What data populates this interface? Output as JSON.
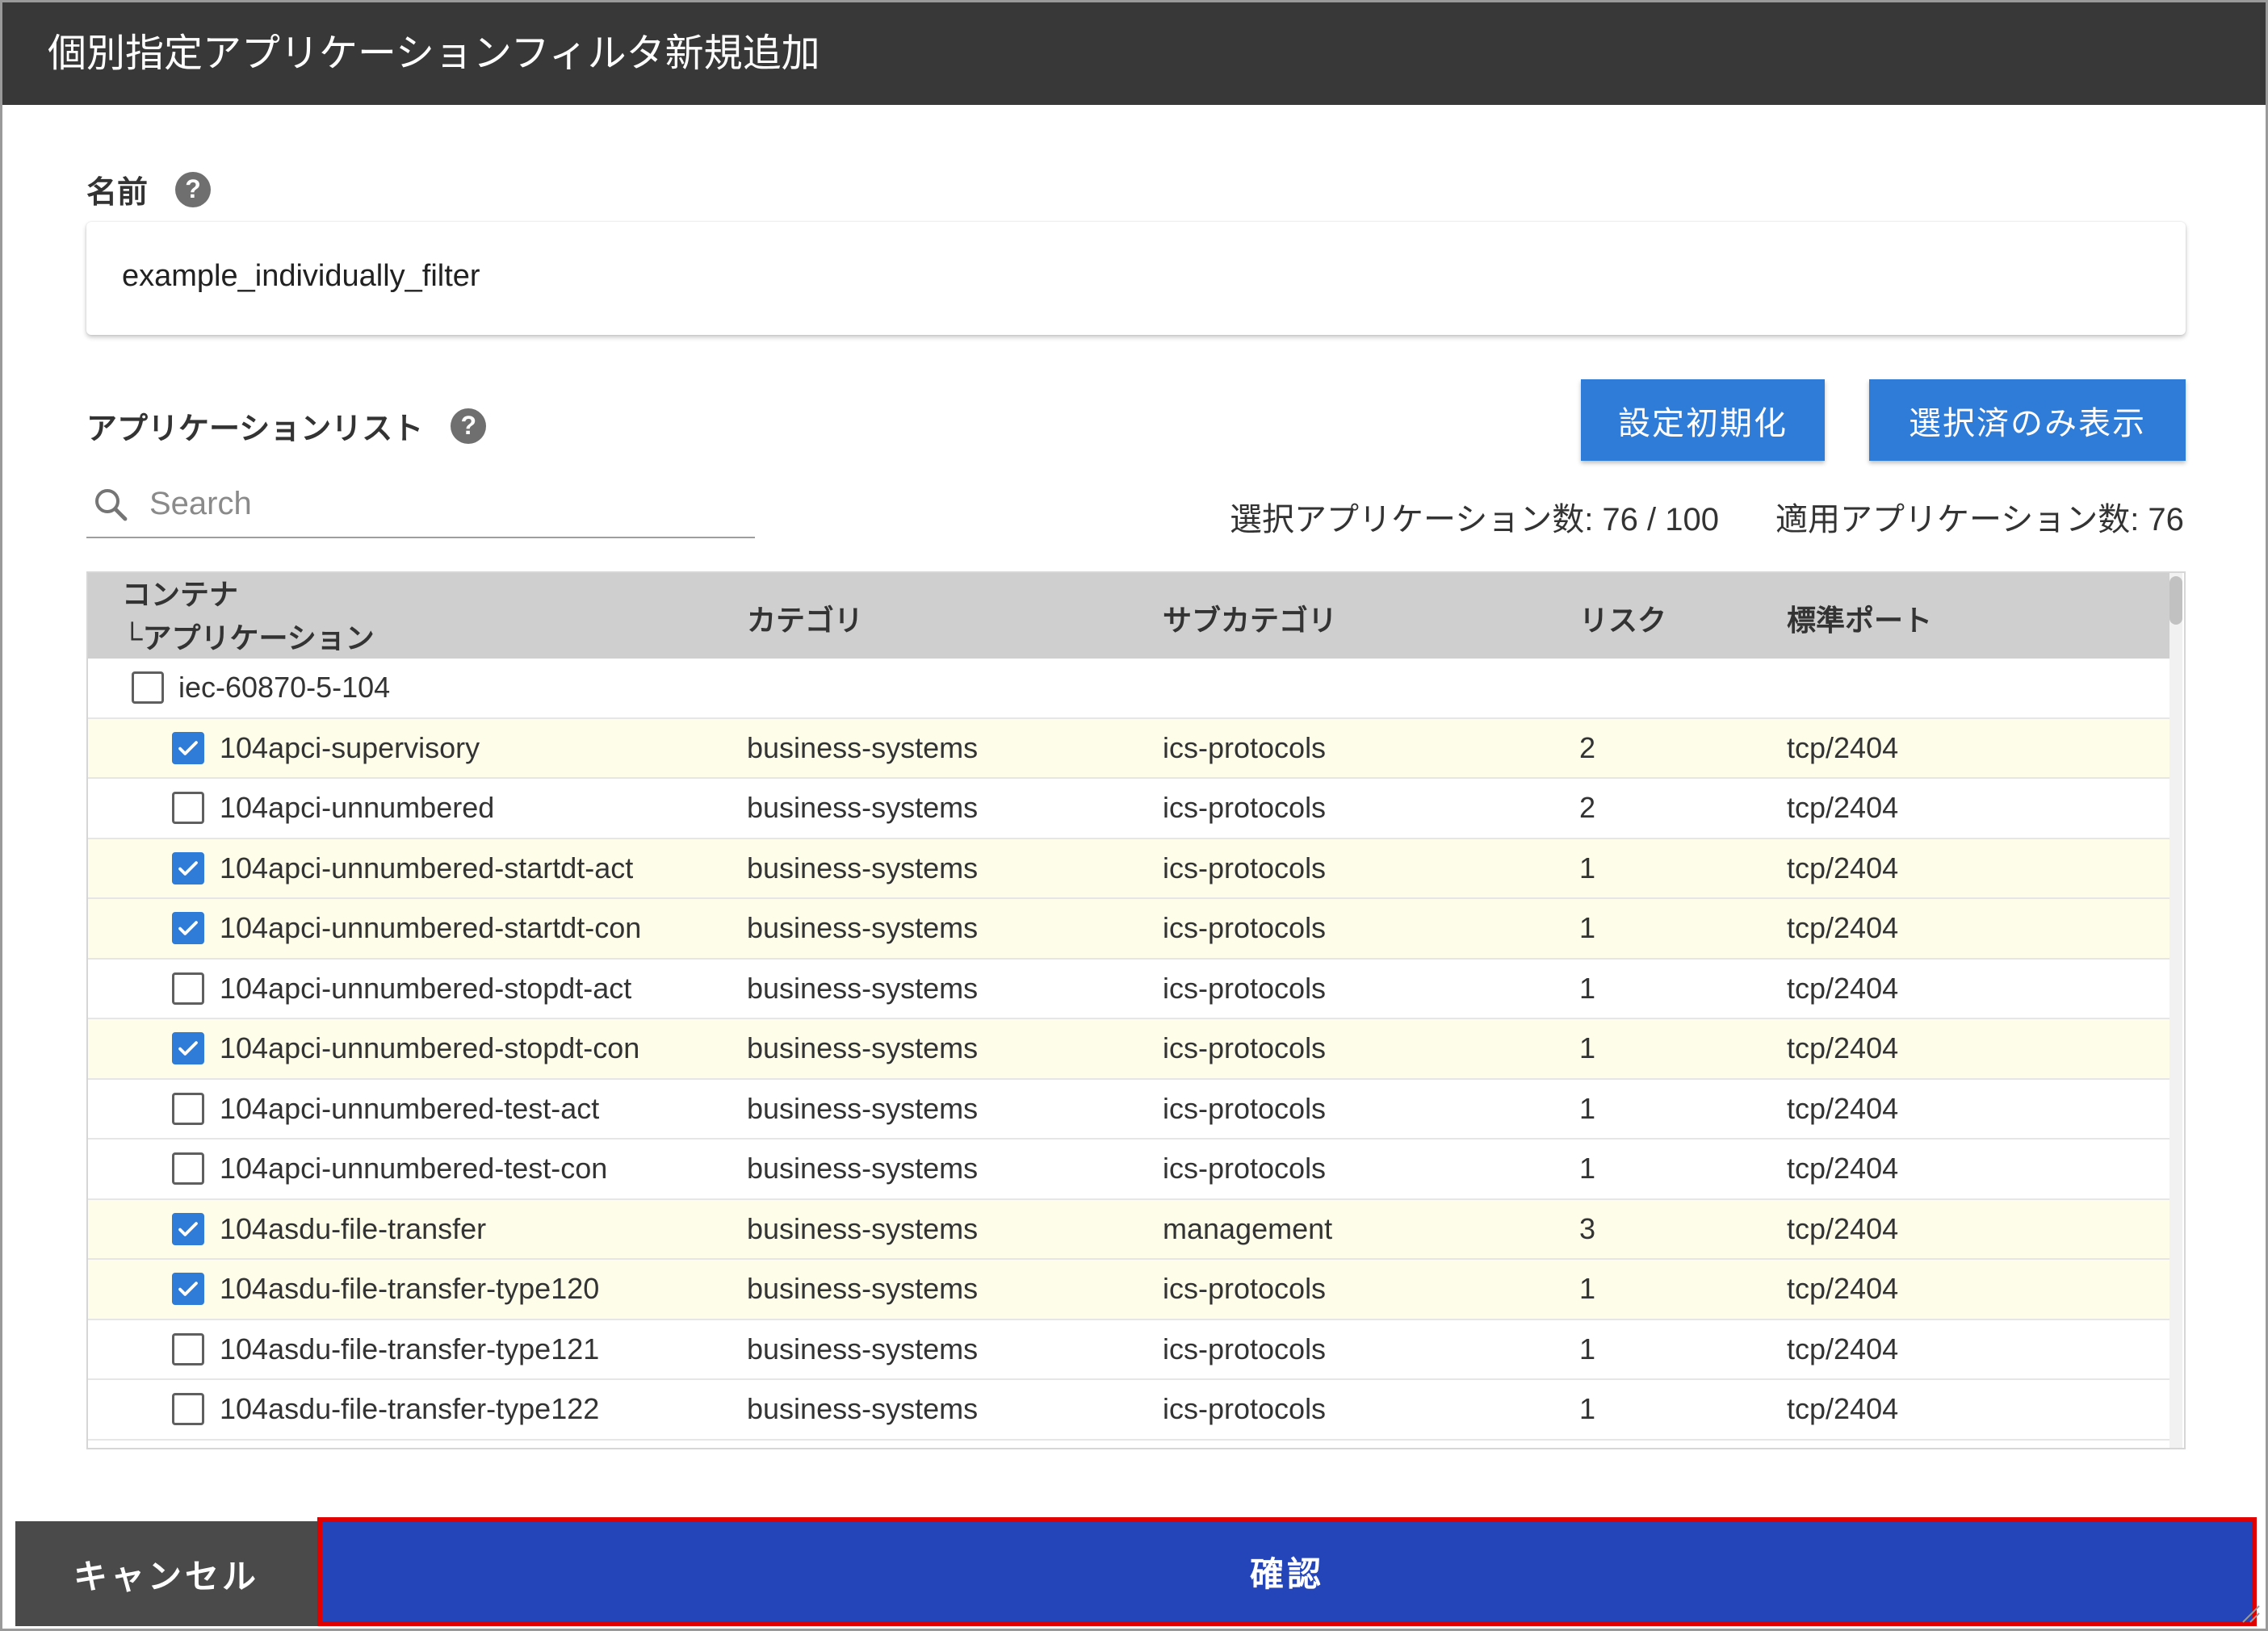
{
  "dialog": {
    "title": "個別指定アプリケーションフィルタ新規追加"
  },
  "name_field": {
    "label": "名前",
    "help": "?",
    "value": "example_individually_filter"
  },
  "app_list": {
    "label": "アプリケーションリスト",
    "help": "?",
    "reset_button": "設定初期化",
    "show_selected_button": "選択済のみ表示",
    "search_placeholder": "Search",
    "selected_count_text": "選択アプリケーション数: 76 / 100",
    "applied_count_text": "適用アプリケーション数: 76"
  },
  "table": {
    "headers": {
      "container_line1": "コンテナ",
      "container_line2": "└アプリケーション",
      "category": "カテゴリ",
      "subcategory": "サブカテゴリ",
      "risk": "リスク",
      "port": "標準ポート"
    },
    "group": {
      "name": "iec-60870-5-104",
      "checked": false
    },
    "rows": [
      {
        "name": "104apci-supervisory",
        "category": "business-systems",
        "subcategory": "ics-protocols",
        "risk": "2",
        "port": "tcp/2404",
        "checked": true
      },
      {
        "name": "104apci-unnumbered",
        "category": "business-systems",
        "subcategory": "ics-protocols",
        "risk": "2",
        "port": "tcp/2404",
        "checked": false
      },
      {
        "name": "104apci-unnumbered-startdt-act",
        "category": "business-systems",
        "subcategory": "ics-protocols",
        "risk": "1",
        "port": "tcp/2404",
        "checked": true
      },
      {
        "name": "104apci-unnumbered-startdt-con",
        "category": "business-systems",
        "subcategory": "ics-protocols",
        "risk": "1",
        "port": "tcp/2404",
        "checked": true
      },
      {
        "name": "104apci-unnumbered-stopdt-act",
        "category": "business-systems",
        "subcategory": "ics-protocols",
        "risk": "1",
        "port": "tcp/2404",
        "checked": false
      },
      {
        "name": "104apci-unnumbered-stopdt-con",
        "category": "business-systems",
        "subcategory": "ics-protocols",
        "risk": "1",
        "port": "tcp/2404",
        "checked": true
      },
      {
        "name": "104apci-unnumbered-test-act",
        "category": "business-systems",
        "subcategory": "ics-protocols",
        "risk": "1",
        "port": "tcp/2404",
        "checked": false
      },
      {
        "name": "104apci-unnumbered-test-con",
        "category": "business-systems",
        "subcategory": "ics-protocols",
        "risk": "1",
        "port": "tcp/2404",
        "checked": false
      },
      {
        "name": "104asdu-file-transfer",
        "category": "business-systems",
        "subcategory": "management",
        "risk": "3",
        "port": "tcp/2404",
        "checked": true
      },
      {
        "name": "104asdu-file-transfer-type120",
        "category": "business-systems",
        "subcategory": "ics-protocols",
        "risk": "1",
        "port": "tcp/2404",
        "checked": true
      },
      {
        "name": "104asdu-file-transfer-type121",
        "category": "business-systems",
        "subcategory": "ics-protocols",
        "risk": "1",
        "port": "tcp/2404",
        "checked": false
      },
      {
        "name": "104asdu-file-transfer-type122",
        "category": "business-systems",
        "subcategory": "ics-protocols",
        "risk": "1",
        "port": "tcp/2404",
        "checked": false
      }
    ]
  },
  "footer": {
    "cancel_label": "キャンセル",
    "confirm_label": "確認"
  },
  "colors": {
    "header_bg": "#383838",
    "primary_button": "#2f7bd8",
    "confirm_button": "#2444b9",
    "highlight_border": "#e00000",
    "checked_row_bg": "#fdfde9",
    "cancel_button": "#4a4a4a"
  }
}
